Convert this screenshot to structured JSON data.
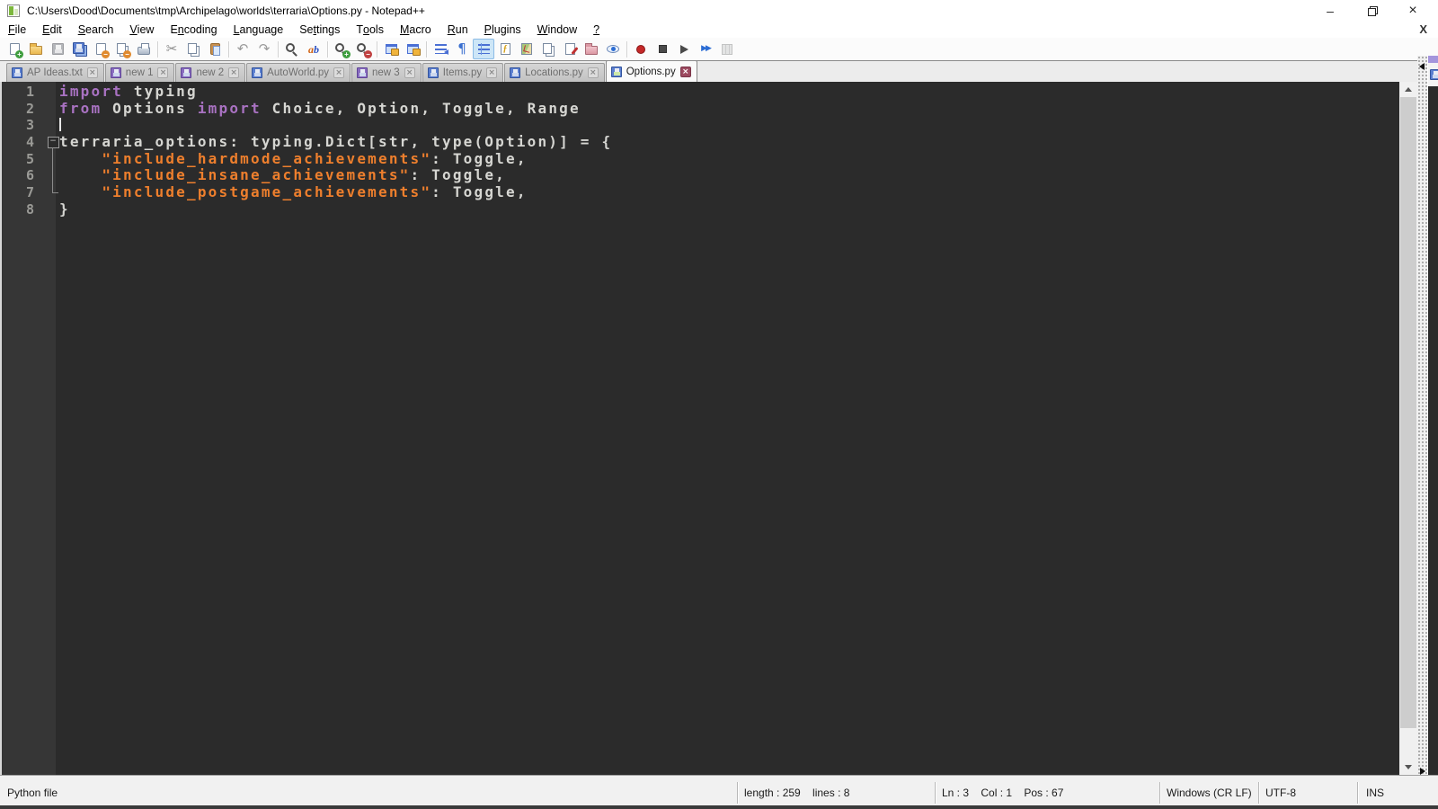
{
  "window": {
    "title": "C:\\Users\\Dood\\Documents\\tmp\\Archipelago\\worlds\\terraria\\Options.py - Notepad++",
    "minimize_glyph": "–",
    "close_glyph": "×"
  },
  "menu": {
    "items": [
      {
        "label": "File",
        "u": 0
      },
      {
        "label": "Edit",
        "u": 0
      },
      {
        "label": "Search",
        "u": 0
      },
      {
        "label": "View",
        "u": 0
      },
      {
        "label": "Encoding",
        "u": 1
      },
      {
        "label": "Language",
        "u": 0
      },
      {
        "label": "Settings",
        "u": 2
      },
      {
        "label": "Tools",
        "u": 1
      },
      {
        "label": "Macro",
        "u": 0
      },
      {
        "label": "Run",
        "u": 0
      },
      {
        "label": "Plugins",
        "u": 0
      },
      {
        "label": "Window",
        "u": 0
      },
      {
        "label": "?",
        "u": 0
      }
    ],
    "close_glyph": "X"
  },
  "toolbar": {
    "items": [
      {
        "name": "new-file",
        "kind": "page",
        "badge": {
          "t": "+",
          "bg": "#3f9e3f"
        }
      },
      {
        "name": "open-file",
        "kind": "folder"
      },
      {
        "name": "save",
        "kind": "floppy",
        "dim": true
      },
      {
        "name": "save-all",
        "kind": "floppy2"
      },
      {
        "name": "close",
        "kind": "page",
        "badge": {
          "t": "−",
          "bg": "#e08a2e"
        }
      },
      {
        "name": "close-all",
        "kind": "page2",
        "badge": {
          "t": "−",
          "bg": "#e08a2e"
        }
      },
      {
        "name": "print",
        "kind": "printer"
      },
      {
        "sep": true
      },
      {
        "name": "cut",
        "kind": "glyph",
        "glyph": "✂",
        "color": "#8c8c8c"
      },
      {
        "name": "copy",
        "kind": "page2"
      },
      {
        "name": "paste",
        "kind": "clip"
      },
      {
        "sep": true
      },
      {
        "name": "undo",
        "kind": "glyph",
        "glyph": "↶",
        "color": "#9a9a9a"
      },
      {
        "name": "redo",
        "kind": "glyph",
        "glyph": "↷",
        "color": "#9a9a9a"
      },
      {
        "sep": true
      },
      {
        "name": "find",
        "kind": "mag"
      },
      {
        "name": "replace",
        "kind": "ab",
        "glyph": "ab",
        "colors": [
          "#d06010",
          "#2b50c0"
        ]
      },
      {
        "sep": true
      },
      {
        "name": "zoom-in",
        "kind": "mag",
        "badge": {
          "t": "+",
          "bg": "#3f9e3f"
        }
      },
      {
        "name": "zoom-out",
        "kind": "mag",
        "badge": {
          "t": "−",
          "bg": "#c04040"
        }
      },
      {
        "sep": true
      },
      {
        "name": "sync-scroll-vertical",
        "kind": "winlock"
      },
      {
        "name": "sync-scroll-horizontal",
        "kind": "winlock"
      },
      {
        "sep": true
      },
      {
        "name": "word-wrap",
        "kind": "wrap"
      },
      {
        "name": "show-all-characters",
        "kind": "glyph",
        "glyph": "¶",
        "color": "#3a6fd0"
      },
      {
        "name": "show-indent-guide",
        "kind": "indent",
        "pressed": true
      },
      {
        "name": "function-list",
        "kind": "funclist",
        "glyph": "ƒ"
      },
      {
        "name": "document-map",
        "kind": "docmap"
      },
      {
        "name": "document-list",
        "kind": "page2"
      },
      {
        "name": "document-edit",
        "kind": "penpage"
      },
      {
        "name": "folder-as-workspace",
        "kind": "folder2"
      },
      {
        "name": "monitoring",
        "kind": "eye"
      },
      {
        "sep": true
      },
      {
        "name": "macro-record",
        "kind": "rec"
      },
      {
        "name": "macro-stop",
        "kind": "stopsq"
      },
      {
        "name": "macro-play",
        "kind": "playtri"
      },
      {
        "name": "macro-run-multiple",
        "kind": "ff",
        "glyph": "▶▶",
        "color": "#2b6cd4"
      },
      {
        "name": "macro-save",
        "kind": "grid",
        "dim": true
      }
    ]
  },
  "tabs": [
    {
      "label": "AP Ideas.txt",
      "state": "saved"
    },
    {
      "label": "new 1",
      "state": "modified"
    },
    {
      "label": "new 2",
      "state": "modified"
    },
    {
      "label": "AutoWorld.py",
      "state": "saved"
    },
    {
      "label": "new 3",
      "state": "modified"
    },
    {
      "label": "Items.py",
      "state": "saved"
    },
    {
      "label": "Locations.py",
      "state": "saved"
    },
    {
      "label": "Options.py",
      "state": "active",
      "active": true
    }
  ],
  "tab_close_glyph": "×",
  "editor": {
    "colors": {
      "background": "#2b2b2b",
      "margin": "#363636",
      "default_text": "#d6d6d2",
      "keyword": "#a972c2",
      "string": "#ee7f2d",
      "line_number": "#9a9a96",
      "caret": "#e8e8e8"
    },
    "lines": [
      {
        "n": "1",
        "tokens": [
          [
            "kw",
            "import"
          ],
          [
            "def",
            " typing"
          ]
        ]
      },
      {
        "n": "2",
        "tokens": [
          [
            "kw",
            "from"
          ],
          [
            "def",
            " Options "
          ],
          [
            "kw",
            "import"
          ],
          [
            "def",
            " Choice, Option, Toggle, Range"
          ]
        ]
      },
      {
        "n": "3",
        "tokens": [],
        "caret": true
      },
      {
        "n": "4",
        "fold": "box",
        "tokens": [
          [
            "def",
            "terraria_options: typing.Dict[str, type(Option)] = {"
          ]
        ]
      },
      {
        "n": "5",
        "fold": "v",
        "tokens": [
          [
            "def",
            "    "
          ],
          [
            "str",
            "\"include_hardmode_achievements\""
          ],
          [
            "def",
            ": Toggle,"
          ]
        ]
      },
      {
        "n": "6",
        "fold": "v",
        "tokens": [
          [
            "def",
            "    "
          ],
          [
            "str",
            "\"include_insane_achievements\""
          ],
          [
            "def",
            ": Toggle,"
          ]
        ]
      },
      {
        "n": "7",
        "fold": "end",
        "tokens": [
          [
            "def",
            "    "
          ],
          [
            "str",
            "\"include_postgame_achievements\""
          ],
          [
            "def",
            ": Toggle,"
          ]
        ]
      },
      {
        "n": "8",
        "tokens": [
          [
            "def",
            "}"
          ]
        ]
      }
    ]
  },
  "status": {
    "doc_type": "Python file",
    "length_lines": "length : 259    lines : 8",
    "position": "Ln : 3    Col : 1    Pos : 67",
    "eol": "Windows (CR LF)",
    "encoding": "UTF-8",
    "mode": "INS"
  }
}
